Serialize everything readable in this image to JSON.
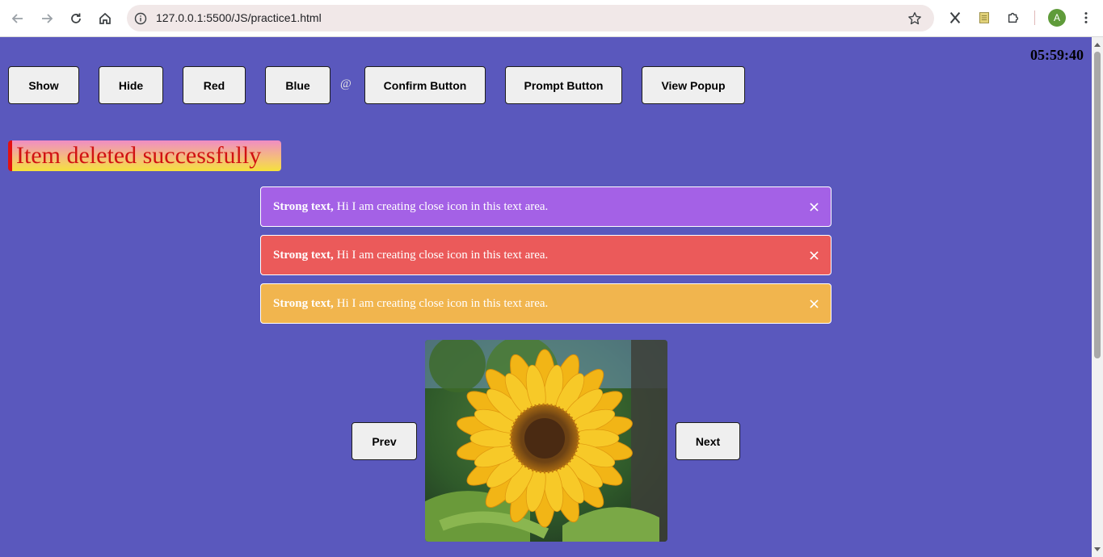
{
  "browser": {
    "url": "127.0.0.1:5500/JS/practice1.html",
    "avatar_letter": "A",
    "icons": [
      "back-icon",
      "forward-icon",
      "reload-icon",
      "home-icon",
      "site-info-icon",
      "bookmark-star-icon",
      "x-extension-icon",
      "notes-extension-icon",
      "puzzle-extensions-icon",
      "menu-kebab-icon"
    ]
  },
  "page": {
    "clock": "05:59:40",
    "buttons": {
      "show": "Show",
      "hide": "Hide",
      "red": "Red",
      "blue": "Blue",
      "at_sign": "@",
      "confirm": "Confirm Button",
      "prompt": "Prompt Button",
      "popup": "View Popup"
    },
    "toast": "Item deleted successfully",
    "alerts": [
      {
        "strong": "Strong text,",
        "text": "Hi I am creating close icon in this text area.",
        "color": "#a461e6"
      },
      {
        "strong": "Strong text,",
        "text": "Hi I am creating close icon in this text area.",
        "color": "#eb5a5a"
      },
      {
        "strong": "Strong text,",
        "text": "Hi I am creating close icon in this text area.",
        "color": "#f1b54e"
      }
    ],
    "slider": {
      "prev": "Prev",
      "next": "Next",
      "image_subject": "sunflower"
    }
  },
  "colors": {
    "page_background": "#5a58bd",
    "toast_text": "#d11212"
  }
}
